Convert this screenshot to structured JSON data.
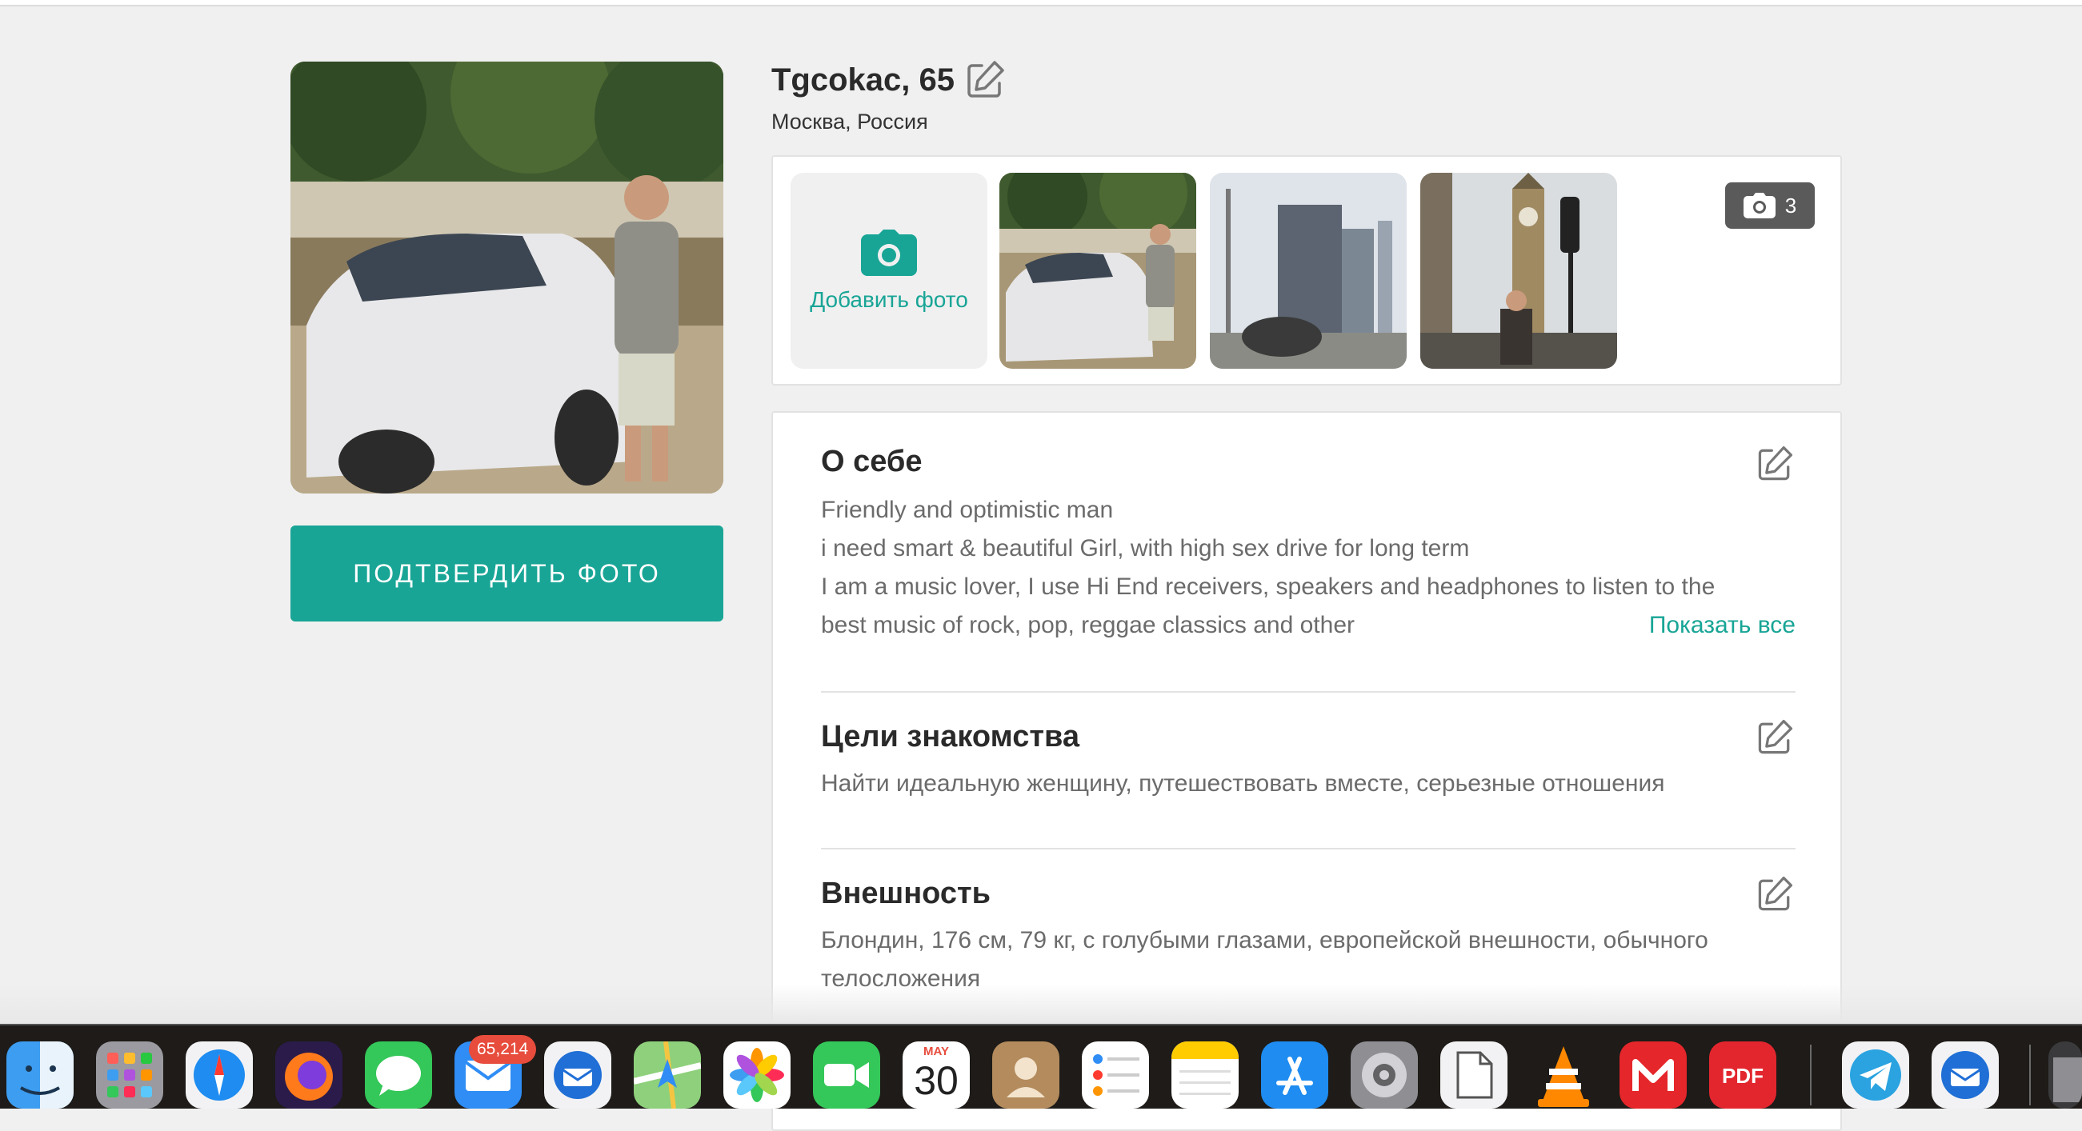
{
  "profile": {
    "name_age": "Tgcokac, 65",
    "location": "Москва, Россия",
    "confirm_photo_label": "ПОДТВЕРДИТЬ ФОТО"
  },
  "photos": {
    "add_label": "Добавить фото",
    "count": "3"
  },
  "about": {
    "title": "О себе",
    "lines": [
      "Friendly and optimistic man",
      "i need smart & beautiful Girl, with high sex drive for long term",
      "I am a music lover, I use Hi End receivers, speakers and headphones to listen to the",
      "best music of rock, pop, reggae classics and other"
    ],
    "show_all": "Показать все"
  },
  "goals": {
    "title": "Цели знакомства",
    "text": "Найти идеальную женщину, путешествовать вместе, серьезные отношения"
  },
  "appearance": {
    "title": "Внешность",
    "lines": [
      "Блондин, 176 см, 79 кг, с голубыми глазами, европейской внешности, обычного",
      "телосложения"
    ]
  },
  "dock": {
    "mail_badge": "65,214",
    "calendar_month": "MAY",
    "calendar_day": "30",
    "pdf_label": "PDF",
    "apps": [
      "finder-icon",
      "launchpad-icon",
      "safari-icon",
      "firefox-icon",
      "messages-icon",
      "mail-icon",
      "thunderbird-icon",
      "maps-icon",
      "photos-icon",
      "facetime-icon",
      "calendar-icon",
      "contacts-icon",
      "reminders-icon",
      "notes-icon",
      "app-store-icon",
      "system-settings-icon",
      "preview-icon",
      "vlc-icon",
      "mail-ru-icon",
      "pdf-expert-icon",
      "telegram-icon",
      "thunderbird-icon",
      "trash-icon"
    ]
  },
  "colors": {
    "accent": "#18a596",
    "background": "#f0f0f0",
    "title_text": "#2a2a2a",
    "body_text": "#6b6b6b"
  }
}
